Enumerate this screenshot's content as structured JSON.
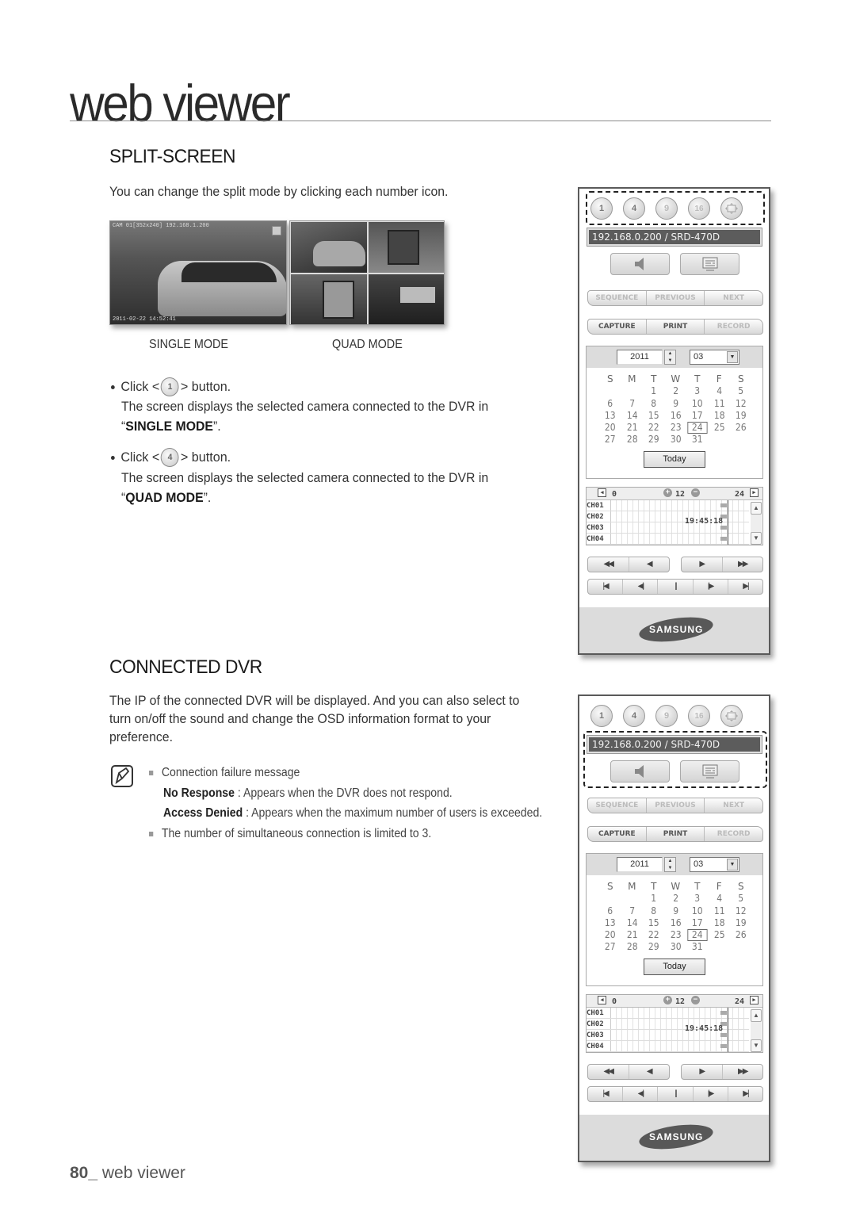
{
  "chapter_title": "web viewer",
  "split_screen": {
    "heading": "SPLIT-SCREEN",
    "intro": "You can change the split mode by clicking each number icon.",
    "thumb_single": {
      "caption": "SINGLE MODE",
      "osd_top": "CAM 01[352x240] 192.168.1.200",
      "osd_bottom": "2011-02-22 14:52:41"
    },
    "thumb_quad": {
      "caption": "QUAD MODE"
    },
    "bullets": [
      {
        "click_prefix": "Click <",
        "icon_label": "1",
        "click_suffix": "> button.",
        "line2": "The screen displays the selected camera connected to the DVR in",
        "mode_open": "“",
        "mode": "SINGLE MODE",
        "mode_close": "”."
      },
      {
        "click_prefix": "Click <",
        "icon_label": "4",
        "click_suffix": "> button.",
        "line2": "The screen displays the selected camera connected to the DVR in",
        "mode_open": "“",
        "mode": "QUAD MODE",
        "mode_close": "”."
      }
    ]
  },
  "connected_dvr": {
    "heading": "CONNECTED DVR",
    "para_lines": [
      "The IP of the connected DVR will be displayed. And you can also select to",
      "turn on/off the sound and change the OSD information format to your",
      "preference."
    ],
    "note": {
      "item1": "Connection failure message",
      "no_response_term": "No Response",
      "no_response_desc": " : Appears when the DVR does not respond.",
      "access_denied_term": "Access Denied",
      "access_denied_desc": " : Appears when the maximum number of users is exceeded.",
      "item2": "The number of simultaneous connection is limited to 3."
    }
  },
  "dvr_panel": {
    "split_buttons": [
      "1",
      "4",
      "9",
      "16"
    ],
    "ip_label": "192.168.0.200   / SRD-470D",
    "nav_buttons": [
      "SEQUENCE",
      "PREVIOUS",
      "NEXT"
    ],
    "action_buttons": [
      "CAPTURE",
      "PRINT",
      "RECORD"
    ],
    "calendar": {
      "year": "2011",
      "month": "03",
      "weekdays": [
        "S",
        "M",
        "T",
        "W",
        "T",
        "F",
        "S"
      ],
      "days": [
        "",
        "",
        "1",
        "2",
        "3",
        "4",
        "5",
        "6",
        "7",
        "8",
        "9",
        "10",
        "11",
        "12",
        "13",
        "14",
        "15",
        "16",
        "17",
        "18",
        "19",
        "20",
        "21",
        "22",
        "23",
        "24",
        "25",
        "26",
        "27",
        "28",
        "29",
        "30",
        "31"
      ],
      "selected_day": "24",
      "today_label": "Today"
    },
    "timeline": {
      "start": "0",
      "mid": "12",
      "end": "24",
      "channels": [
        "CH01",
        "CH02",
        "CH03",
        "CH04"
      ],
      "time": "19:45:18"
    },
    "playback_row1": [
      "◀◀",
      "◀",
      "▶",
      "▶▶"
    ],
    "playback_row2": [
      "|◀",
      "◀|",
      "||",
      "|▶",
      "▶|"
    ],
    "brand": "SAMSUNG"
  },
  "footer": {
    "page": "80_",
    "label": " web viewer"
  }
}
